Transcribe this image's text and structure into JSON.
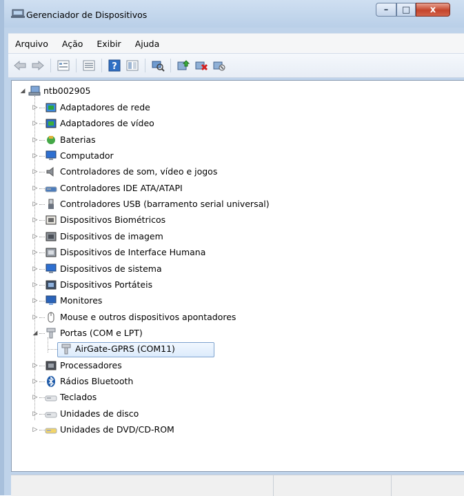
{
  "window": {
    "title": "Gerenciador de Dispositivos"
  },
  "caption_buttons": {
    "minimize": "–",
    "maximize": "□",
    "close": "x"
  },
  "menu": {
    "items": [
      {
        "label": "Arquivo",
        "accel": "A"
      },
      {
        "label": "Ação",
        "accel": "o"
      },
      {
        "label": "Exibir",
        "accel": "x"
      },
      {
        "label": "Ajuda",
        "accel": "u"
      }
    ]
  },
  "toolbar": {
    "icons": [
      "back-arrow-icon",
      "forward-arrow-icon",
      "properties-icon",
      "list-icon",
      "help-icon",
      "view-icon",
      "scan-hardware-icon",
      "update-driver-icon",
      "uninstall-icon",
      "disable-icon"
    ]
  },
  "tree": {
    "root": "ntb002905",
    "categories": [
      {
        "label": "Adaptadores de rede",
        "icon": "network-adapter-icon"
      },
      {
        "label": "Adaptadores de vídeo",
        "icon": "display-adapter-icon"
      },
      {
        "label": "Baterias",
        "icon": "battery-icon"
      },
      {
        "label": "Computador",
        "icon": "computer-icon"
      },
      {
        "label": "Controladores de som, vídeo e jogos",
        "icon": "speaker-icon"
      },
      {
        "label": "Controladores IDE ATA/ATAPI",
        "icon": "ide-controller-icon"
      },
      {
        "label": "Controladores USB (barramento serial universal)",
        "icon": "usb-icon"
      },
      {
        "label": "Dispositivos Biométricos",
        "icon": "fingerprint-icon"
      },
      {
        "label": "Dispositivos de imagem",
        "icon": "camera-icon"
      },
      {
        "label": "Dispositivos de Interface Humana",
        "icon": "hid-icon"
      },
      {
        "label": "Dispositivos de sistema",
        "icon": "system-device-icon"
      },
      {
        "label": "Dispositivos Portáteis",
        "icon": "portable-device-icon"
      },
      {
        "label": "Monitores",
        "icon": "monitor-icon"
      },
      {
        "label": "Mouse e outros dispositivos apontadores",
        "icon": "mouse-icon"
      },
      {
        "label": "Portas (COM e LPT)",
        "icon": "port-icon",
        "expanded": true
      },
      {
        "label": "Processadores",
        "icon": "processor-icon"
      },
      {
        "label": "Rádios Bluetooth",
        "icon": "bluetooth-icon"
      },
      {
        "label": "Teclados",
        "icon": "keyboard-icon"
      },
      {
        "label": "Unidades de disco",
        "icon": "disk-drive-icon"
      },
      {
        "label": "Unidades de DVD/CD-ROM",
        "icon": "dvd-drive-icon"
      }
    ],
    "selected_child": {
      "label": "AirGate-GPRS (COM11)",
      "icon": "port-icon"
    }
  },
  "colors": {
    "selection_border": "#7da2ce",
    "selection_fill": "#dcebfc",
    "close_button": "#c4452c"
  }
}
